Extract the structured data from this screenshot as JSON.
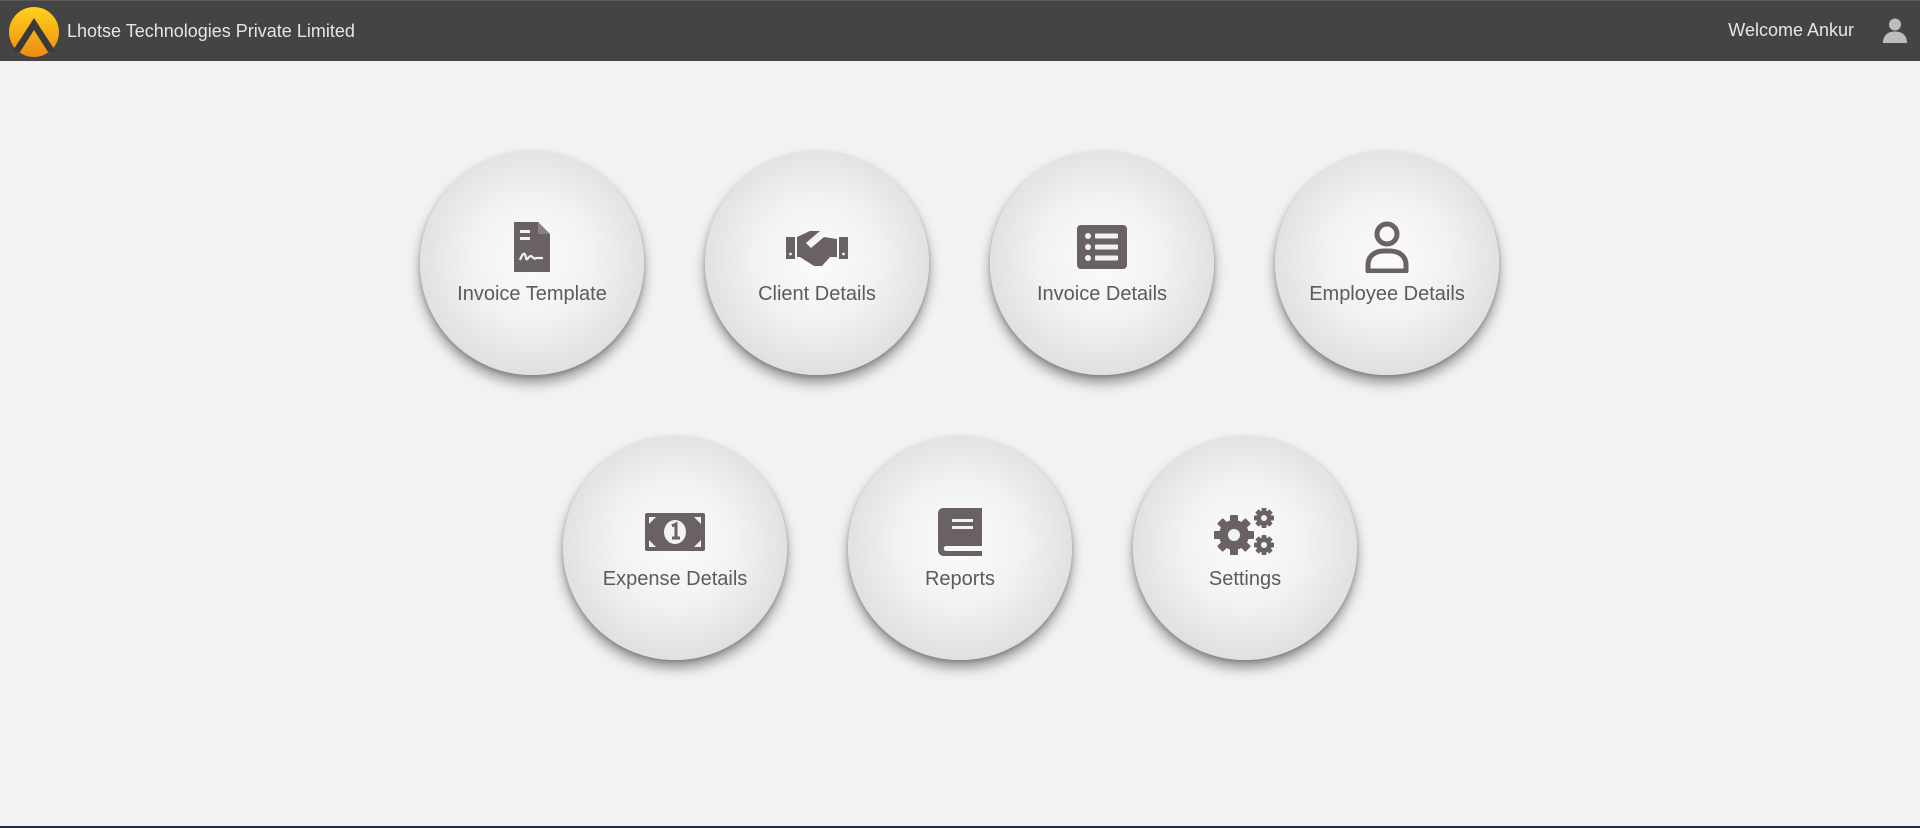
{
  "header": {
    "company_name": "Lhotse Technologies Private Limited",
    "welcome_text": "Welcome Ankur",
    "user_icon": "user-icon",
    "logo_icon": "mountain-logo"
  },
  "colors": {
    "topbar": "#444444",
    "background": "#f3f1f2",
    "icon": "#6a6262",
    "logo_orange": "#f0a11d",
    "logo_yellow": "#ffd21a"
  },
  "tiles": [
    {
      "label": "Invoice Template",
      "icon": "signed-document-icon"
    },
    {
      "label": "Client Details",
      "icon": "handshake-icon"
    },
    {
      "label": "Invoice Details",
      "icon": "list-icon"
    },
    {
      "label": "Employee Details",
      "icon": "user-outline-icon"
    },
    {
      "label": "Expense Details",
      "icon": "money-bill-icon"
    },
    {
      "label": "Reports",
      "icon": "book-icon"
    },
    {
      "label": "Settings",
      "icon": "gears-icon"
    }
  ]
}
